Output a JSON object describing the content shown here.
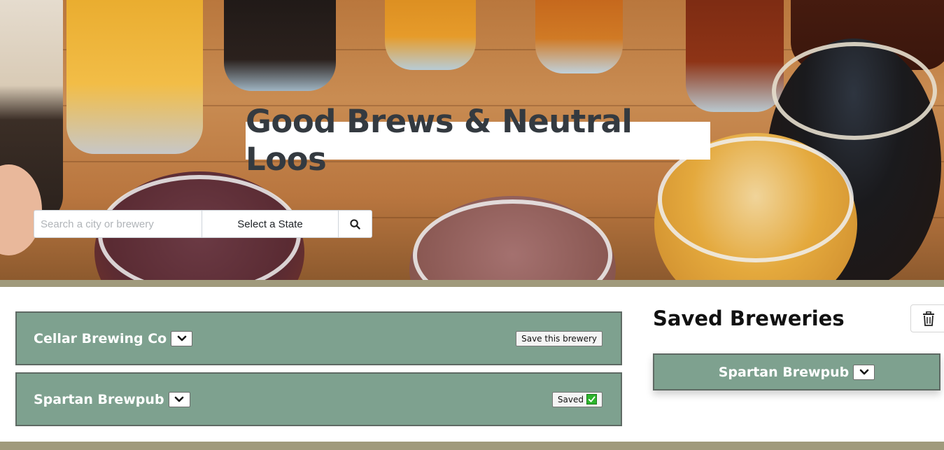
{
  "hero": {
    "title": "Good Brews & Neutral Loos",
    "search_placeholder": "Search a city or brewery",
    "state_select_label": "Select a State",
    "search_icon": "magnifier-icon"
  },
  "results": [
    {
      "name": "Cellar Brewing Co",
      "save_label": "Save this brewery",
      "saved": false
    },
    {
      "name": "Spartan Brewpub",
      "save_label": "Saved",
      "saved": true
    }
  ],
  "saved_panel": {
    "title": "Saved Breweries",
    "clear_icon": "trash-icon",
    "items": [
      {
        "name": "Spartan Brewpub"
      }
    ]
  },
  "colors": {
    "card_bg": "#7ea18f",
    "band": "#a09a7c",
    "title_text": "#343a40",
    "check_green": "#2db52d"
  }
}
